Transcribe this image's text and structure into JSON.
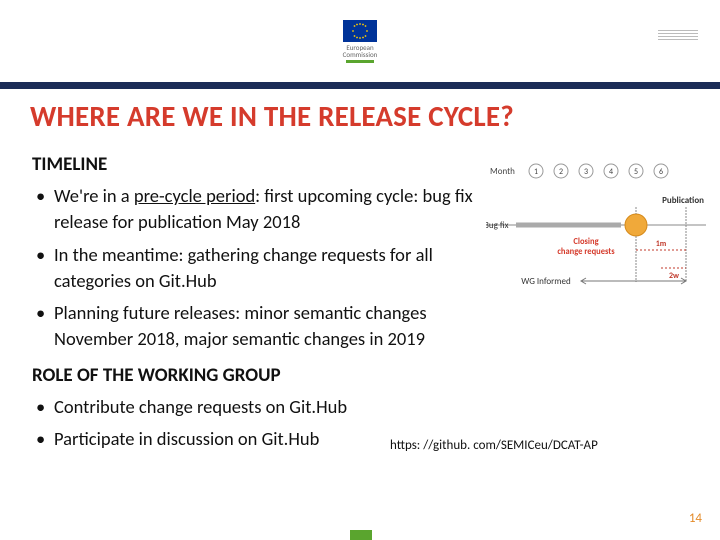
{
  "logo": {
    "line1": "European",
    "line2": "Commission"
  },
  "title": "WHERE ARE WE IN THE RELEASE CYCLE?",
  "section1": {
    "heading": "TIMELINE",
    "bullets": [
      {
        "prefix": "We're in a ",
        "emph": "pre-cycle period",
        "suffix": ": first upcoming cycle: bug fix release for publication May 2018"
      },
      "In the meantime: gathering change requests for all categories on Git.Hub",
      "Planning future releases: minor semantic changes November 2018, major semantic changes in 2019"
    ]
  },
  "section2": {
    "heading": "ROLE OF THE WORKING GROUP",
    "bullets": [
      "Contribute change requests on Git.Hub",
      "Participate in discussion on Git.Hub"
    ]
  },
  "url": "https: //github. com/SEMICeu/DCAT-AP",
  "page_number": "14",
  "diagram": {
    "month_label": "Month",
    "months": [
      "1",
      "2",
      "3",
      "4",
      "5",
      "6"
    ],
    "publication": "Publication",
    "bugfix": "Bug fix",
    "closing_requests_l1": "Closing",
    "closing_requests_l2": "change requests",
    "one_m": "1m",
    "two_w": "2w",
    "wg_informed": "WG Informed"
  }
}
